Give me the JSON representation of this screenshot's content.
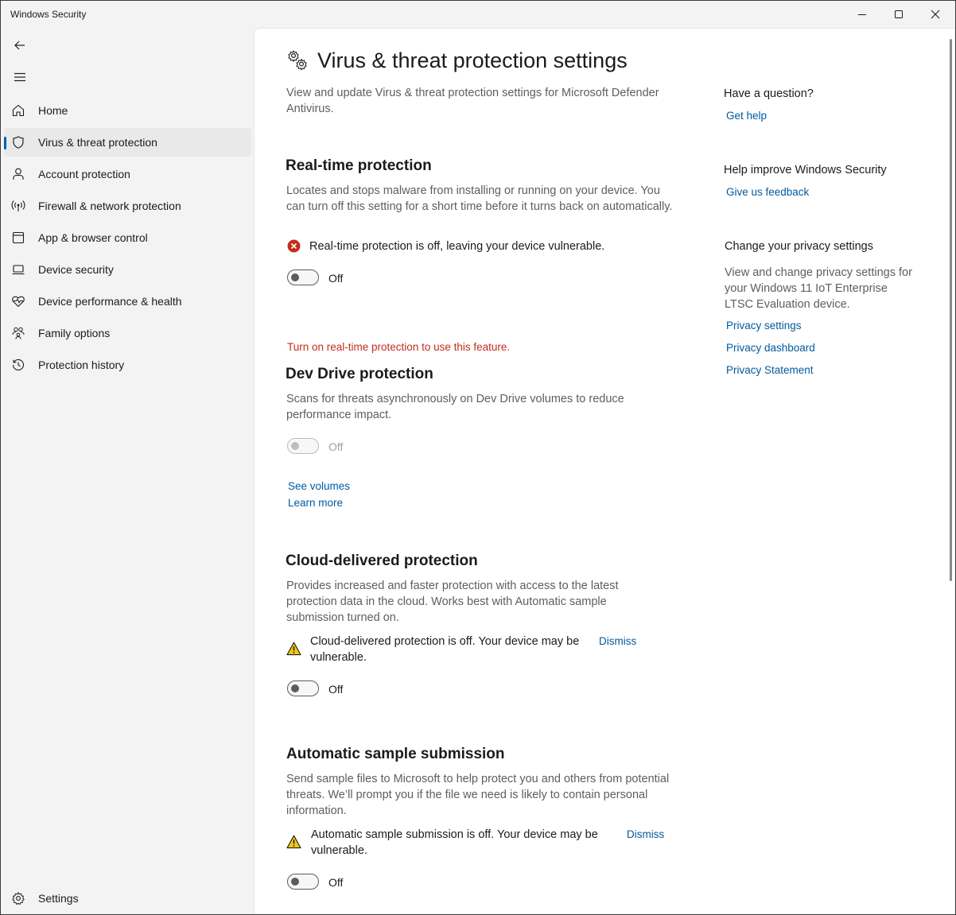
{
  "window": {
    "title": "Windows Security",
    "minimize": "minimize-icon",
    "maximize": "maximize-icon",
    "close": "close-icon"
  },
  "sidebar": {
    "back": "back-arrow-icon",
    "menu": "hamburger-menu-icon",
    "items": [
      {
        "label": "Home",
        "icon": "home-icon"
      },
      {
        "label": "Virus & threat protection",
        "icon": "shield-icon",
        "active": true
      },
      {
        "label": "Account protection",
        "icon": "person-icon"
      },
      {
        "label": "Firewall & network protection",
        "icon": "wireless-signal-icon"
      },
      {
        "label": "App & browser control",
        "icon": "browser-window-icon"
      },
      {
        "label": "Device security",
        "icon": "laptop-icon"
      },
      {
        "label": "Device performance & health",
        "icon": "heart-pulse-icon"
      },
      {
        "label": "Family options",
        "icon": "family-icon"
      },
      {
        "label": "Protection history",
        "icon": "history-icon"
      }
    ],
    "settings_label": "Settings",
    "settings_icon": "gear-icon"
  },
  "main": {
    "title": "Virus & threat protection settings",
    "title_icon": "gears-icon",
    "intro": "View and update Virus & threat protection settings for Microsoft Defender Antivirus.",
    "realtime": {
      "heading": "Real-time protection",
      "description": "Locates and stops malware from installing or running on your device. You can turn off this setting for a short time before it turns back on automatically.",
      "status": "Real-time protection is off, leaving your device vulnerable.",
      "status_icon": "error-circle-icon",
      "toggle_label": "Off",
      "toggle_on": false
    },
    "devdrive": {
      "error": "Turn on real-time protection to use this feature.",
      "heading": "Dev Drive protection",
      "description": "Scans for threats asynchronously on Dev Drive volumes to reduce performance impact.",
      "toggle_label": "Off",
      "toggle_on": false,
      "toggle_disabled": true,
      "link_volumes": "See volumes",
      "link_learn": "Learn more"
    },
    "cloud": {
      "heading": "Cloud-delivered protection",
      "description": "Provides increased and faster protection with access to the latest protection data in the cloud. Works best with Automatic sample submission turned on.",
      "status": "Cloud-delivered protection is off. Your device may be vulnerable.",
      "status_icon": "warning-triangle-icon",
      "dismiss": "Dismiss",
      "toggle_label": "Off",
      "toggle_on": false
    },
    "sample": {
      "heading": "Automatic sample submission",
      "description": "Send sample files to Microsoft to help protect you and others from potential threats. We’ll prompt you if the file we need is likely to contain personal information.",
      "status": "Automatic sample submission is off. Your device may be vulnerable.",
      "status_icon": "warning-triangle-icon",
      "dismiss": "Dismiss",
      "toggle_label": "Off",
      "toggle_on": false
    }
  },
  "aside": {
    "question_heading": "Have a question?",
    "get_help": "Get help",
    "improve_heading": "Help improve Windows Security",
    "feedback": "Give us feedback",
    "privacy_heading": "Change your privacy settings",
    "privacy_text": "View and change privacy settings for your Windows 11 IoT Enterprise LTSC Evaluation device.",
    "privacy_settings": "Privacy settings",
    "privacy_dashboard": "Privacy dashboard",
    "privacy_statement": "Privacy Statement"
  },
  "colors": {
    "accent": "#005fb8",
    "link": "#005a9e",
    "error": "#c42b1c",
    "warning": "#f2c811"
  }
}
